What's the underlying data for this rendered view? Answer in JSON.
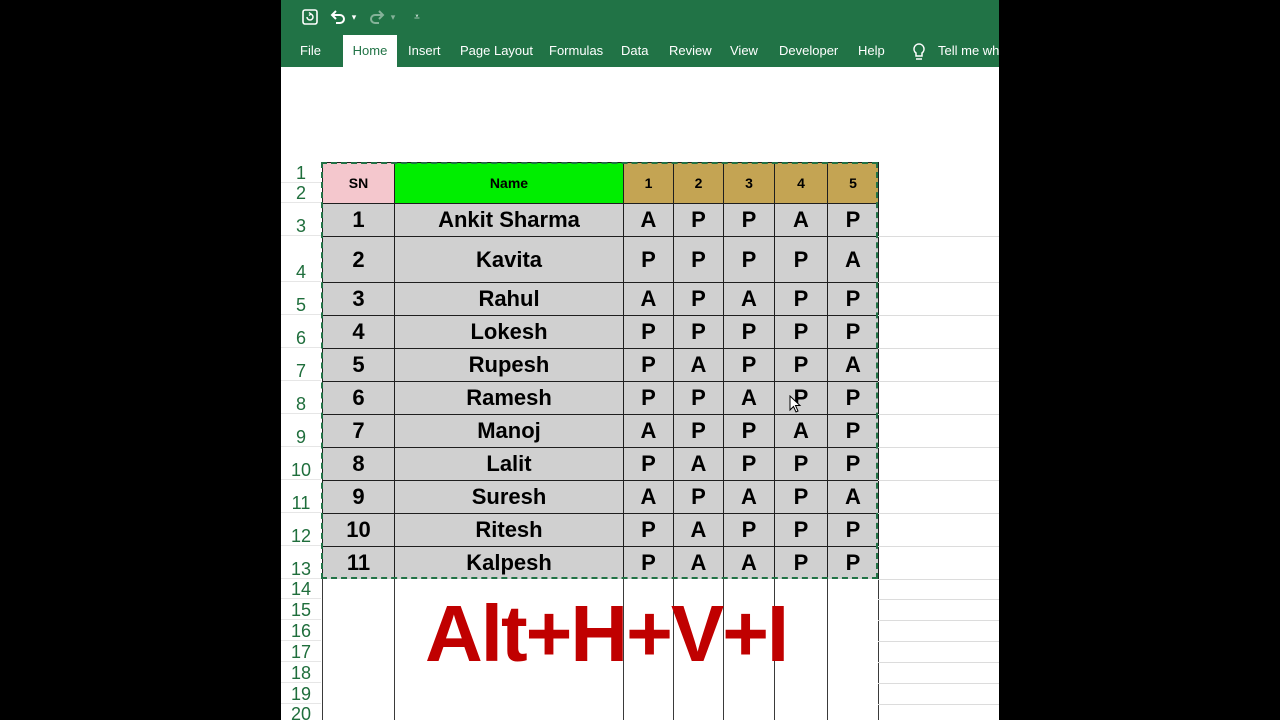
{
  "ribbon": {
    "tabs": [
      "File",
      "Home",
      "Insert",
      "Page Layout",
      "Formulas",
      "Data",
      "Review",
      "View",
      "Developer",
      "Help"
    ],
    "active_tab": "Home",
    "tell_me": "Tell me wh"
  },
  "colors": {
    "excel_green": "#217346",
    "sn_header": "#f4c7cd",
    "name_header": "#00ee00",
    "day_header": "#c4a453",
    "data_fill": "#d0d0d0",
    "overlay_text": "#c00000"
  },
  "row_numbers": [
    "1",
    "2",
    "3",
    "4",
    "5",
    "6",
    "7",
    "8",
    "9",
    "10",
    "11",
    "12",
    "13",
    "14",
    "15",
    "16",
    "17",
    "18",
    "19",
    "20"
  ],
  "table": {
    "headers": {
      "sn": "SN",
      "name": "Name",
      "days": [
        "1",
        "2",
        "3",
        "4",
        "5"
      ]
    },
    "rows": [
      {
        "sn": "1",
        "name": "Ankit Sharma",
        "att": [
          "A",
          "P",
          "P",
          "A",
          "P"
        ]
      },
      {
        "sn": "2",
        "name": "Kavita",
        "att": [
          "P",
          "P",
          "P",
          "P",
          "A"
        ]
      },
      {
        "sn": "3",
        "name": "Rahul",
        "att": [
          "A",
          "P",
          "A",
          "P",
          "P"
        ]
      },
      {
        "sn": "4",
        "name": "Lokesh",
        "att": [
          "P",
          "P",
          "P",
          "P",
          "P"
        ]
      },
      {
        "sn": "5",
        "name": "Rupesh",
        "att": [
          "P",
          "A",
          "P",
          "P",
          "A"
        ]
      },
      {
        "sn": "6",
        "name": "Ramesh",
        "att": [
          "P",
          "P",
          "A",
          "P",
          "P"
        ]
      },
      {
        "sn": "7",
        "name": "Manoj",
        "att": [
          "A",
          "P",
          "P",
          "A",
          "P"
        ]
      },
      {
        "sn": "8",
        "name": "Lalit",
        "att": [
          "P",
          "A",
          "P",
          "P",
          "P"
        ]
      },
      {
        "sn": "9",
        "name": "Suresh",
        "att": [
          "A",
          "P",
          "A",
          "P",
          "A"
        ]
      },
      {
        "sn": "10",
        "name": "Ritesh",
        "att": [
          "P",
          "A",
          "P",
          "P",
          "P"
        ]
      },
      {
        "sn": "11",
        "name": "Kalpesh",
        "att": [
          "P",
          "A",
          "A",
          "P",
          "P"
        ]
      }
    ]
  },
  "overlay_shortcut": "Alt+H+V+I"
}
